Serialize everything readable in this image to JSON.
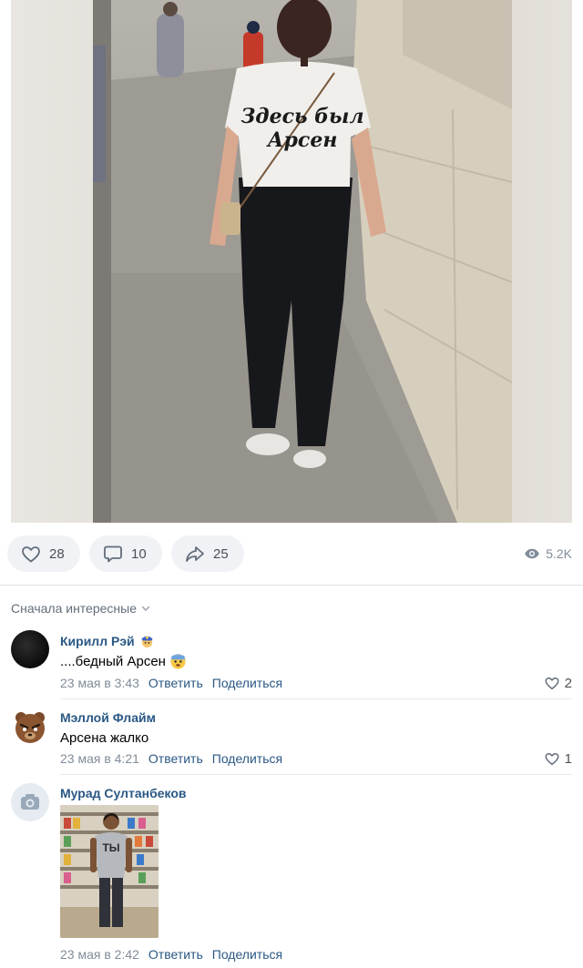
{
  "post": {
    "photo_caption": "Здесь был Арсен",
    "shirt_line1": "Здесь был",
    "shirt_line2": "Арсен"
  },
  "actions": {
    "likes": "28",
    "comments": "10",
    "shares": "25",
    "views": "5.2K"
  },
  "sort_label": "Сначала интересные",
  "comments": [
    {
      "author": "Кирилл Рэй",
      "author_badge_icon": "police-emoji-icon",
      "text": "....бедный Арсен",
      "text_emoji_icon": "scared-face-emoji-icon",
      "date": "23 мая в 3:43",
      "reply": "Ответить",
      "share": "Поделиться",
      "likes": "2"
    },
    {
      "author": "Мэллой Флайм",
      "text": "Арсена жалко",
      "date": "23 мая в 4:21",
      "reply": "Ответить",
      "share": "Поделиться",
      "likes": "1"
    },
    {
      "author": "Мурад Султанбеков",
      "text": "",
      "attachment_caption": "ТЫ",
      "date": "23 мая в 2:42",
      "reply": "Ответить",
      "share": "Поделиться"
    }
  ],
  "colors": {
    "link": "#2a5885",
    "muted": "#818c99",
    "pill_bg": "#f0f2f5",
    "divider": "#dce1e6"
  }
}
